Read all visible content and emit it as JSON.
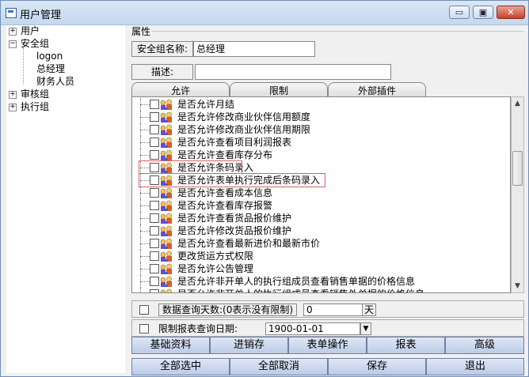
{
  "window": {
    "title": "用户管理",
    "min_glyph": "▭",
    "max_glyph": "▣",
    "close_glyph": "✕"
  },
  "tree": {
    "nodes": [
      {
        "label": "用户",
        "expander": "+"
      },
      {
        "label": "安全组",
        "expander": "−"
      },
      {
        "label": "logon"
      },
      {
        "label": "总经理"
      },
      {
        "label": "财务人员"
      },
      {
        "label": "审核组",
        "expander": "+"
      },
      {
        "label": "执行组",
        "expander": "+"
      }
    ]
  },
  "properties": {
    "heading": "属性",
    "group_name_label": "安全组名称:",
    "group_name_value": "总经理",
    "description_label": "描述:",
    "description_value": ""
  },
  "tabs": [
    "允许",
    "限制",
    "外部插件"
  ],
  "permissions": [
    "是否允许月结",
    "是否允许修改商业伙伴信用额度",
    "是否允许修改商业伙伴信用期限",
    "是否允许查看项目利润报表",
    "是否允许查看库存分布",
    "是否允许条码录入",
    "是否允许表单执行完成后条码录入",
    "是否允许查看成本信息",
    "是否允许查看库存报警",
    "是否允许查看货品报价维护",
    "是否允许修改货品报价维护",
    "是否允许查看最新进价和最新市价",
    "更改货运方式权限",
    "是否允许公告管理",
    "是否允许非开单人的执行组成员查看销售单据的价格信息",
    "是否允许非开单人的执行组成员查看销售外单据的价格信息"
  ],
  "options": {
    "days_label": "数据查询天数:(0表示没有限制)",
    "days_value": "0",
    "days_unit": "天",
    "date_label": "限制报表查询日期:",
    "date_value": "1900-01-01",
    "dropdown_glyph": "▼"
  },
  "category_buttons": [
    "基础资料",
    "进销存",
    "表单操作",
    "报表",
    "高级"
  ],
  "action_buttons": [
    "全部选中",
    "全部取消",
    "保存",
    "退出"
  ],
  "scrollbar": {
    "up": "▲",
    "down": "▼"
  }
}
